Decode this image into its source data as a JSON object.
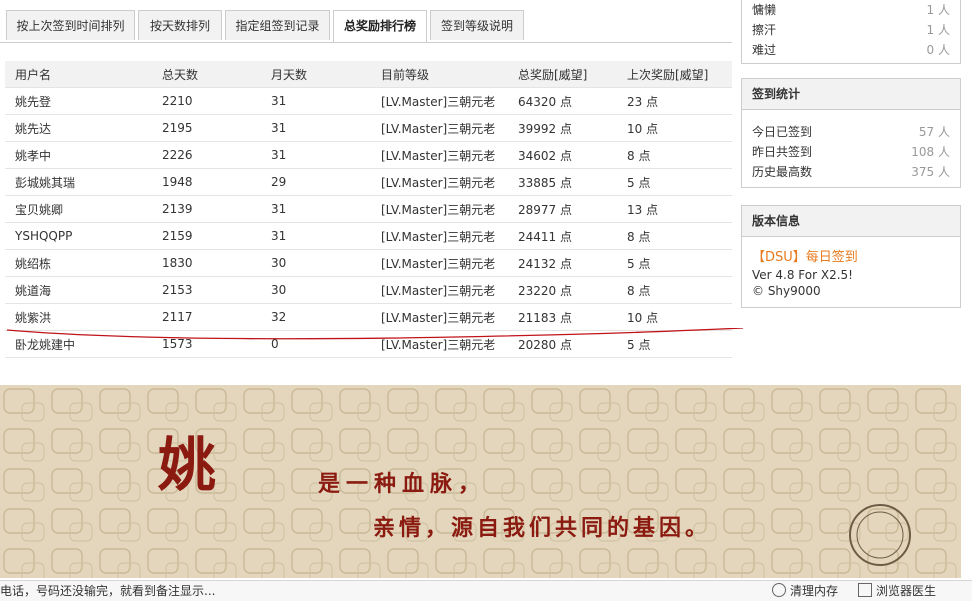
{
  "tabs": [
    {
      "label": "按上次签到时间排列",
      "active": false
    },
    {
      "label": "按天数排列",
      "active": false
    },
    {
      "label": "指定组签到记录",
      "active": false
    },
    {
      "label": "总奖励排行榜",
      "active": true
    },
    {
      "label": "签到等级说明",
      "active": false
    }
  ],
  "table": {
    "headers": [
      "用户名",
      "总天数",
      "月天数",
      "目前等级",
      "总奖励[威望]",
      "上次奖励[威望]"
    ],
    "rows": [
      [
        "姚先登",
        "2210",
        "31",
        "[LV.Master]三朝元老",
        "64320 点",
        "23 点"
      ],
      [
        "姚先达",
        "2195",
        "31",
        "[LV.Master]三朝元老",
        "39992 点",
        "10 点"
      ],
      [
        "姚孝中",
        "2226",
        "31",
        "[LV.Master]三朝元老",
        "34602 点",
        "8 点"
      ],
      [
        "彭城姚其瑞",
        "1948",
        "29",
        "[LV.Master]三朝元老",
        "33885 点",
        "5 点"
      ],
      [
        "宝贝姚卿",
        "2139",
        "31",
        "[LV.Master]三朝元老",
        "28977 点",
        "13 点"
      ],
      [
        "YSHQQPP",
        "2159",
        "31",
        "[LV.Master]三朝元老",
        "24411 点",
        "8 点"
      ],
      [
        "姚绍栋",
        "1830",
        "30",
        "[LV.Master]三朝元老",
        "24132 点",
        "5 点"
      ],
      [
        "姚道海",
        "2153",
        "30",
        "[LV.Master]三朝元老",
        "23220 点",
        "8 点"
      ],
      [
        "姚紫洪",
        "2117",
        "32",
        "[LV.Master]三朝元老",
        "21183 点",
        "10 点"
      ],
      [
        "卧龙姚建中",
        "1573",
        "0",
        "[LV.Master]三朝元老",
        "20280 点",
        "5 点"
      ]
    ]
  },
  "mood": [
    {
      "label": "慵懒",
      "value": "1 人"
    },
    {
      "label": "擦汗",
      "value": "1 人"
    },
    {
      "label": "难过",
      "value": "0 人"
    }
  ],
  "stats": {
    "title": "签到统计",
    "rows": [
      {
        "label": "今日已签到",
        "value": "57 人"
      },
      {
        "label": "昨日共签到",
        "value": "108 人"
      },
      {
        "label": "历史最高数",
        "value": "375 人"
      }
    ]
  },
  "version": {
    "title": "版本信息",
    "plugin": "【DSU】每日签到",
    "ver": "Ver 4.8 For X2.5!",
    "author": "© Shy9000"
  },
  "banner": {
    "char": "姚",
    "line1": "是一种血脉，",
    "line2": "亲情，源自我们共同的基因。"
  },
  "statusbar": {
    "left_text": "电话，号码还没输完，就看到备注显示...",
    "clean_memory": "清理内存",
    "browser_doctor": "浏览器医生"
  },
  "colors": {
    "accent_orange": "#e87a1e",
    "banner_red": "#8b1a10",
    "underline_red": "#c0141a"
  }
}
